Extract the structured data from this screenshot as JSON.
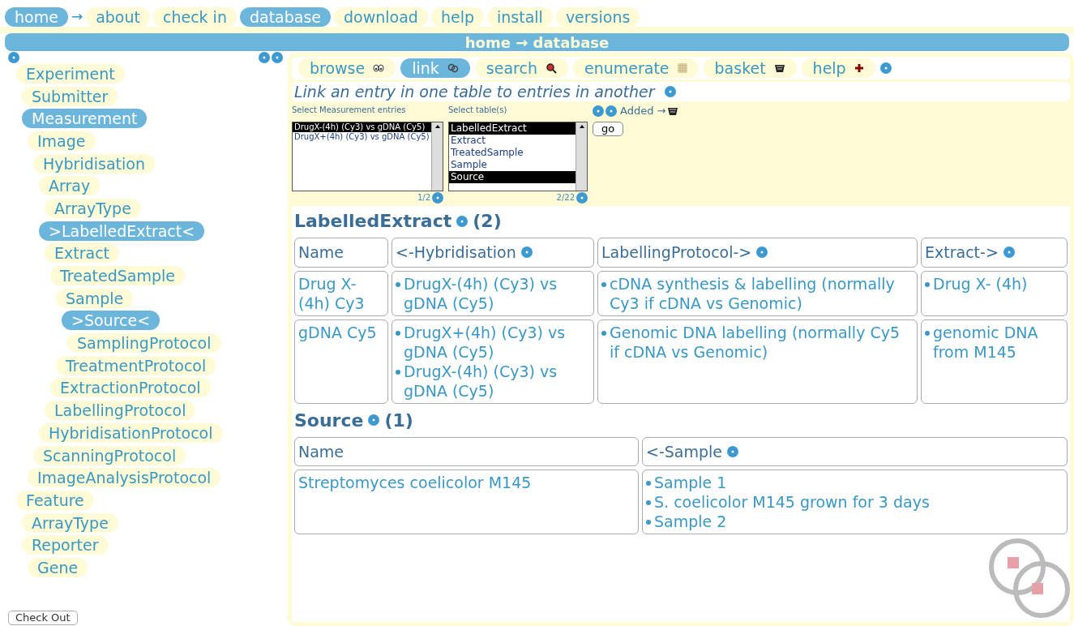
{
  "nav": [
    {
      "label": "home",
      "selected": true,
      "arrow": "→"
    },
    {
      "label": "about",
      "selected": false
    },
    {
      "label": "check in",
      "selected": false
    },
    {
      "label": "database",
      "selected": true
    },
    {
      "label": "download",
      "selected": false
    },
    {
      "label": "help",
      "selected": false
    },
    {
      "label": "install",
      "selected": false
    },
    {
      "label": "versions",
      "selected": false
    }
  ],
  "breadcrumb": "home → database",
  "tree": [
    {
      "label": "Experiment",
      "selected": false,
      "children": [
        {
          "label": "Submitter",
          "selected": false
        },
        {
          "label": "Measurement",
          "selected": true,
          "children": [
            {
              "label": "Image",
              "selected": false,
              "children": [
                {
                  "label": "Hybridisation",
                  "selected": false,
                  "children": [
                    {
                      "label": "Array",
                      "selected": false,
                      "children": [
                        {
                          "label": "ArrayType",
                          "selected": false
                        }
                      ]
                    },
                    {
                      "label": ">LabelledExtract<",
                      "selected": true,
                      "children": [
                        {
                          "label": "Extract",
                          "selected": false,
                          "children": [
                            {
                              "label": "TreatedSample",
                              "selected": false,
                              "children": [
                                {
                                  "label": "Sample",
                                  "selected": false,
                                  "children": [
                                    {
                                      "label": ">Source<",
                                      "selected": true,
                                      "children": [
                                        {
                                          "label": "SamplingProtocol",
                                          "selected": false
                                        }
                                      ]
                                    }
                                  ]
                                },
                                {
                                  "label": "TreatmentProtocol",
                                  "selected": false
                                }
                              ]
                            },
                            {
                              "label": "ExtractionProtocol",
                              "selected": false
                            }
                          ]
                        },
                        {
                          "label": "LabellingProtocol",
                          "selected": false
                        }
                      ]
                    },
                    {
                      "label": "HybridisationProtocol",
                      "selected": false
                    }
                  ]
                },
                {
                  "label": "ScanningProtocol",
                  "selected": false
                }
              ]
            },
            {
              "label": "ImageAnalysisProtocol",
              "selected": false
            }
          ]
        }
      ]
    },
    {
      "label": "Feature",
      "selected": false,
      "children": [
        {
          "label": "ArrayType",
          "selected": false
        },
        {
          "label": "Reporter",
          "selected": false,
          "children": [
            {
              "label": "Gene",
              "selected": false
            }
          ]
        }
      ]
    }
  ],
  "checkout": "Check Out",
  "tabs": [
    {
      "label": "browse",
      "selected": false,
      "kind": "eyes"
    },
    {
      "label": "link",
      "selected": true,
      "kind": "link"
    },
    {
      "label": "search",
      "selected": false,
      "kind": "search"
    },
    {
      "label": "enumerate",
      "selected": false,
      "kind": "grid"
    },
    {
      "label": "basket",
      "selected": false,
      "kind": "basket"
    },
    {
      "label": "help",
      "selected": false,
      "kind": "plus"
    }
  ],
  "subtitle": "Link an entry in one table to entries in another",
  "entries": {
    "label": "Select Measurement entries",
    "options": [
      {
        "label": "DrugX-(4h) (Cy3) vs gDNA (Cy5)",
        "selected": true
      },
      {
        "label": "DrugX+(4h) (Cy3) vs gDNA (Cy5)",
        "selected": false
      }
    ],
    "count": "1/2"
  },
  "tables_select": {
    "label": "Select table(s)",
    "options": [
      {
        "label": "LabelledExtract",
        "selected": true
      },
      {
        "label": "Extract",
        "selected": false
      },
      {
        "label": "TreatedSample",
        "selected": false
      },
      {
        "label": "Sample",
        "selected": false
      },
      {
        "label": "Source",
        "selected": true
      }
    ],
    "count": "2/22"
  },
  "added": "Added →",
  "go": "go",
  "results": [
    {
      "title": "LabelledExtract",
      "count": "(2)",
      "columns": [
        "Name",
        "<-Hybridisation",
        "LabellingProtocol->",
        "Extract->"
      ],
      "info": [
        false,
        true,
        true,
        true
      ],
      "rows": [
        [
          "Drug X-(4h) Cy3",
          [
            "DrugX-(4h) (Cy3) vs gDNA (Cy5)"
          ],
          [
            "cDNA synthesis & labelling (normally Cy3 if cDNA vs Genomic)"
          ],
          [
            "Drug X- (4h)"
          ]
        ],
        [
          "gDNA Cy5",
          [
            "DrugX+(4h) (Cy3) vs gDNA (Cy5)",
            "DrugX-(4h) (Cy3) vs gDNA (Cy5)"
          ],
          [
            "Genomic DNA labelling (normally Cy5 if cDNA vs Genomic)"
          ],
          [
            "genomic DNA from M145"
          ]
        ]
      ]
    },
    {
      "title": "Source",
      "count": "(1)",
      "columns": [
        "Name",
        "<-Sample"
      ],
      "info": [
        false,
        true
      ],
      "rows": [
        [
          "Streptomyces coelicolor M145",
          [
            "Sample 1",
            "S. coelicolor M145 grown for 3 days",
            "Sample 2"
          ]
        ]
      ]
    }
  ]
}
